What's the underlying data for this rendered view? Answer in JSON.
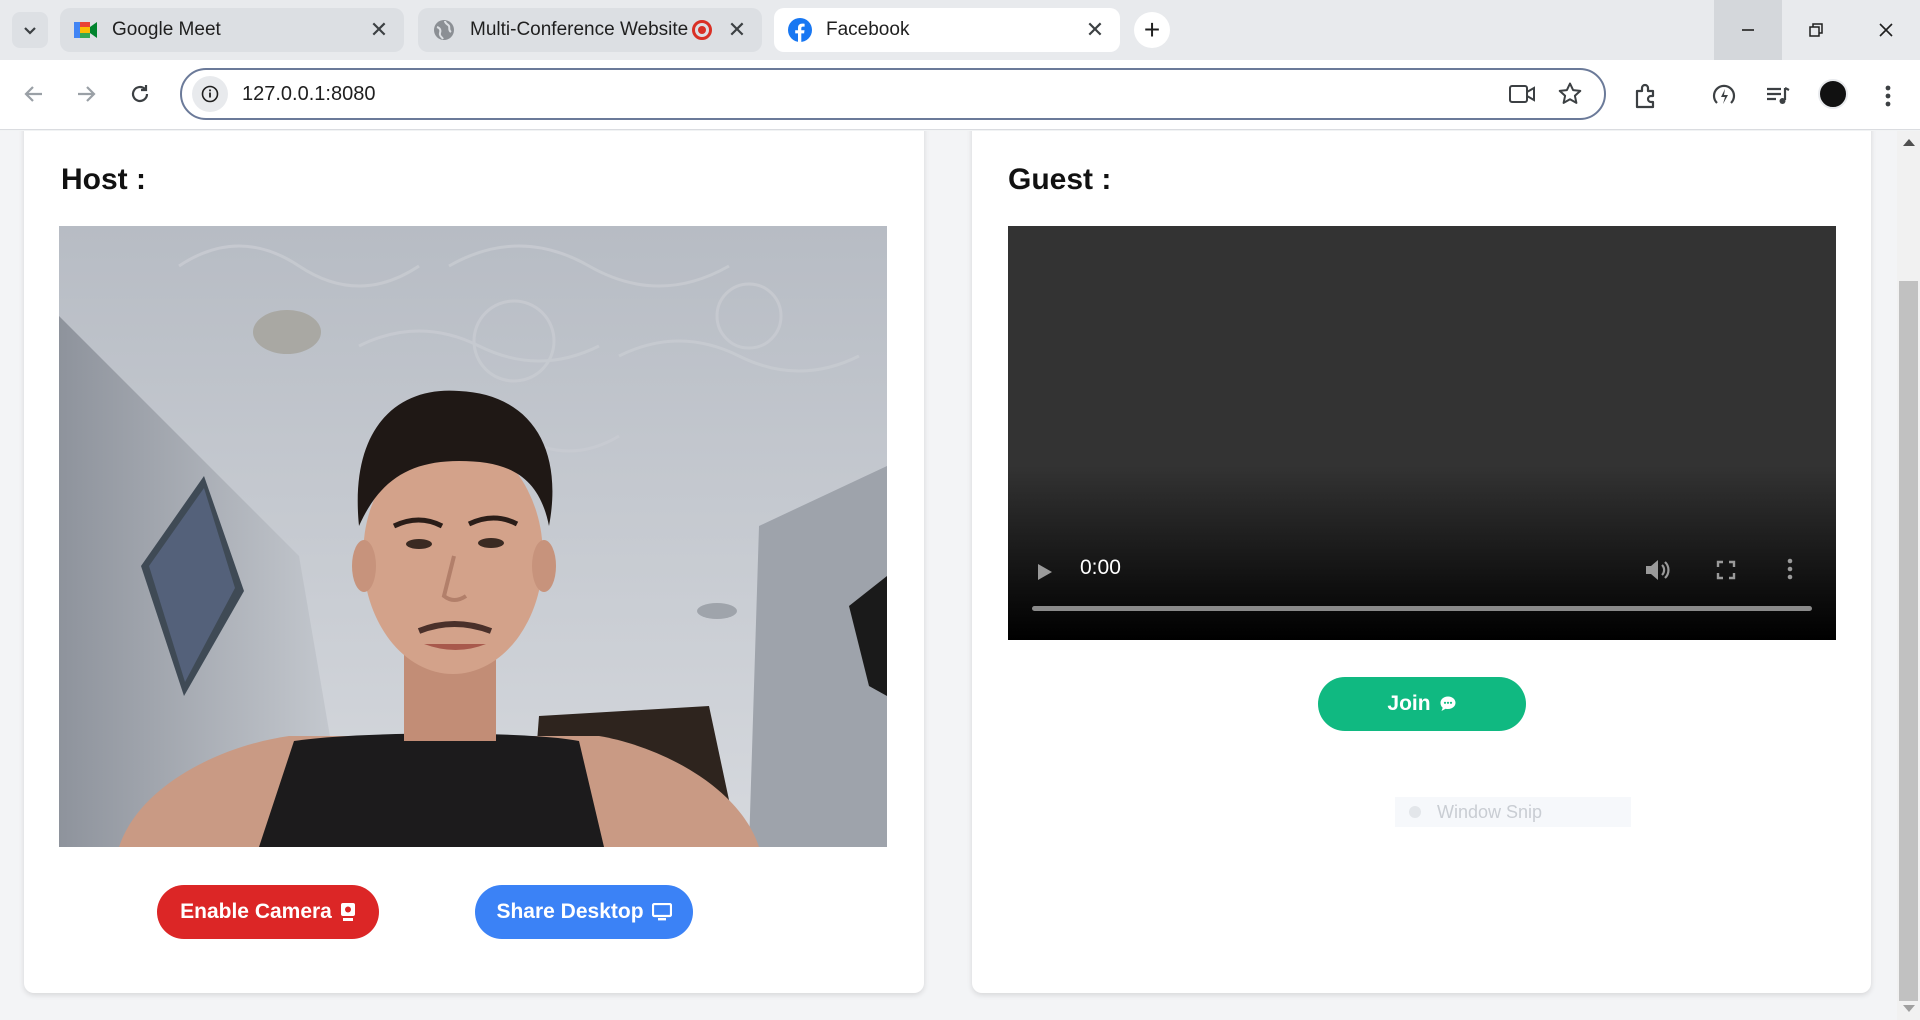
{
  "browser": {
    "tabs": [
      {
        "label": "Google Meet",
        "favicon": "google-meet-icon"
      },
      {
        "label": "Multi-Conference Website",
        "favicon": "globe-icon",
        "recording": true
      },
      {
        "label": "Facebook",
        "favicon": "facebook-icon",
        "active": true
      }
    ],
    "address": "127.0.0.1:8080"
  },
  "page": {
    "host": {
      "title": "Host :",
      "enable_camera_label": "Enable Camera",
      "share_desktop_label": "Share Desktop"
    },
    "guest": {
      "title": "Guest :",
      "video_time": "0:00",
      "join_label": "Join",
      "snip_label": "Window Snip"
    }
  },
  "colors": {
    "enable_camera": "#dc2626",
    "share_desktop": "#3b82f6",
    "join": "#10b981",
    "omnibox_border": "#6b7a99"
  }
}
